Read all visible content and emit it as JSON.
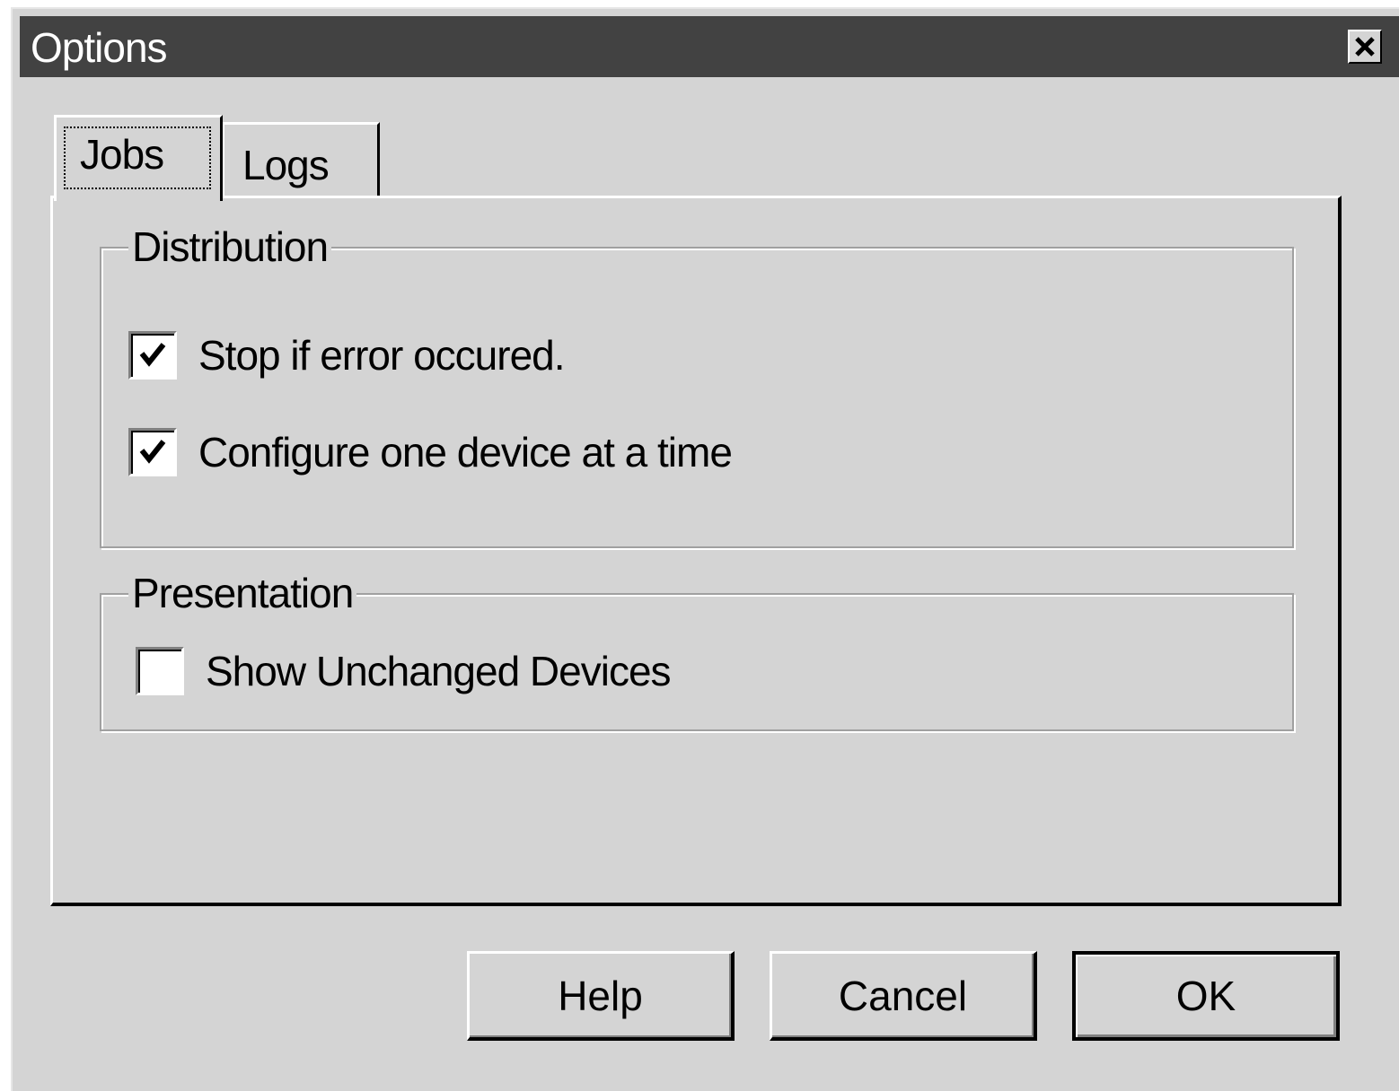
{
  "window": {
    "title": "Options"
  },
  "tabs": [
    {
      "label": "Jobs",
      "active": true
    },
    {
      "label": "Logs",
      "active": false
    }
  ],
  "groups": {
    "distribution": {
      "legend": "Distribution",
      "options": [
        {
          "label": "Stop if error occured.",
          "checked": true
        },
        {
          "label": "Configure one device at a time",
          "checked": true
        }
      ]
    },
    "presentation": {
      "legend": "Presentation",
      "options": [
        {
          "label": "Show Unchanged Devices",
          "checked": false
        }
      ]
    }
  },
  "buttons": {
    "help": "Help",
    "cancel": "Cancel",
    "ok": "OK"
  },
  "icons": {
    "close": "close-icon",
    "check": "checkmark-icon"
  },
  "colors": {
    "titlebar": "#424242",
    "face": "#d4d4d4"
  }
}
